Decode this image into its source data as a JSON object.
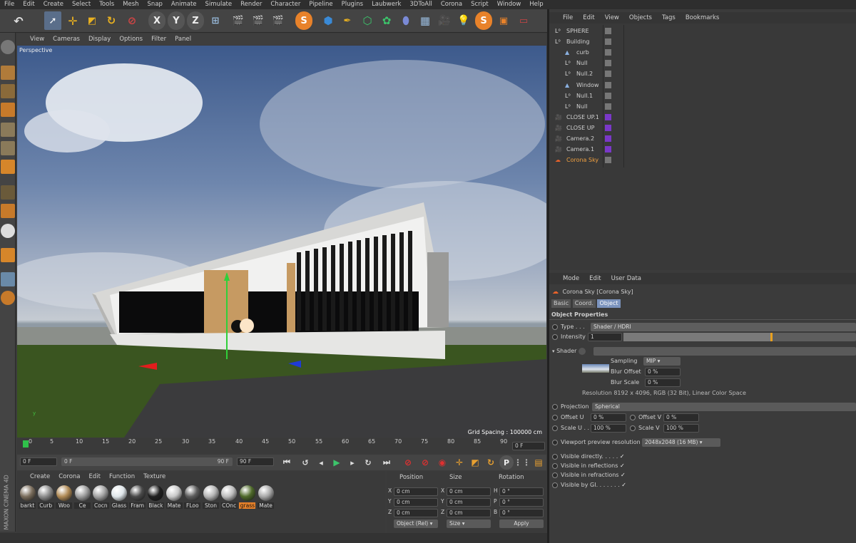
{
  "menu": [
    "File",
    "Edit",
    "Create",
    "Select",
    "Tools",
    "Mesh",
    "Snap",
    "Animate",
    "Simulate",
    "Render",
    "Character",
    "Pipeline",
    "Plugins",
    "Laubwerk",
    "3DToAll",
    "Corona",
    "Script",
    "Window",
    "Help"
  ],
  "toolbar": {
    "axis_x": "X",
    "axis_y": "Y",
    "axis_z": "Z",
    "icons": [
      "undo-icon",
      "select-arrow-icon",
      "move-icon",
      "scale-icon",
      "rotate-icon",
      "recent-tool-icon",
      "axis-lock-x",
      "axis-lock-y",
      "axis-lock-z",
      "world-coordinate-icon",
      "render-view-icon",
      "render-picture-viewer-icon",
      "render-settings-icon",
      "corona-icon",
      "cube-icon",
      "pen-icon",
      "subdivision-icon",
      "cloner-icon",
      "deformer-icon",
      "floor-icon",
      "camera-icon",
      "light-icon",
      "corona-logo-icon",
      "cinema-layout-icon"
    ]
  },
  "viewport": {
    "menu": [
      "View",
      "Cameras",
      "Display",
      "Options",
      "Filter",
      "Panel"
    ],
    "label": "Perspective",
    "grid_spacing": "Grid Spacing : 100000 cm"
  },
  "timeline": {
    "ticks": [
      "0",
      "5",
      "10",
      "15",
      "20",
      "25",
      "30",
      "35",
      "40",
      "45",
      "50",
      "55",
      "60",
      "65",
      "70",
      "75",
      "80",
      "85",
      "90"
    ],
    "current_frame": "0 F"
  },
  "transport": {
    "start": "0 F",
    "min": "0 F",
    "max": "90 F",
    "end": "90 F"
  },
  "materials": {
    "menu": [
      "Create",
      "Corona",
      "Edit",
      "Function",
      "Texture"
    ],
    "items": [
      {
        "label": "barkt",
        "color": "#7a6d5c"
      },
      {
        "label": "Curb",
        "color": "#8d8d8d"
      },
      {
        "label": "Woo",
        "color": "#b08a55"
      },
      {
        "label": "Ce",
        "color": "#9c9c9c"
      },
      {
        "label": "Cocn",
        "color": "#a3a3a3"
      },
      {
        "label": "Glass",
        "color": "#dfe6ea"
      },
      {
        "label": "Fram",
        "color": "#4a4a4a"
      },
      {
        "label": "Black",
        "color": "#202020"
      },
      {
        "label": "Mate",
        "color": "#c9c9c9"
      },
      {
        "label": "FLoo",
        "color": "#5c5c5c"
      },
      {
        "label": "Ston",
        "color": "#b5b5b5"
      },
      {
        "label": "COnc",
        "color": "#bdbdbd"
      },
      {
        "label": "grass",
        "color": "#4f6a2a"
      },
      {
        "label": "Mate",
        "color": "#a8a8a8"
      }
    ]
  },
  "coords": {
    "headers": {
      "position": "Position",
      "size": "Size",
      "rotation": "Rotation"
    },
    "rows": [
      {
        "axis": "X",
        "pos": "0 cm",
        "size_axis": "X",
        "size": "0 cm",
        "rot_axis": "H",
        "rot": "0 °"
      },
      {
        "axis": "Y",
        "pos": "0 cm",
        "size_axis": "Y",
        "size": "0 cm",
        "rot_axis": "P",
        "rot": "0 °"
      },
      {
        "axis": "Z",
        "pos": "0 cm",
        "size_axis": "Z",
        "size": "0 cm",
        "rot_axis": "B",
        "rot": "0 °"
      }
    ],
    "mode": "Object (Rel)",
    "size_mode": "Size",
    "apply": "Apply"
  },
  "objects": {
    "menu": [
      "File",
      "Edit",
      "View",
      "Objects",
      "Tags",
      "Bookmarks"
    ],
    "items": [
      {
        "name": "SPHERE",
        "indent": 0,
        "type": "null"
      },
      {
        "name": "Building",
        "indent": 0,
        "type": "null"
      },
      {
        "name": "curb",
        "indent": 1,
        "type": "poly"
      },
      {
        "name": "Null",
        "indent": 1,
        "type": "null"
      },
      {
        "name": "Null.2",
        "indent": 1,
        "type": "null"
      },
      {
        "name": "Window",
        "indent": 1,
        "type": "poly"
      },
      {
        "name": "Null.1",
        "indent": 1,
        "type": "null"
      },
      {
        "name": "Null",
        "indent": 1,
        "type": "null"
      },
      {
        "name": "CLOSE UP.1",
        "indent": 0,
        "type": "camera"
      },
      {
        "name": "CLOSE UP",
        "indent": 0,
        "type": "camera"
      },
      {
        "name": "Camera.2",
        "indent": 0,
        "type": "camera"
      },
      {
        "name": "Camera.1",
        "indent": 0,
        "type": "camera"
      },
      {
        "name": "Corona Sky",
        "indent": 0,
        "type": "sky"
      }
    ]
  },
  "attributes": {
    "menu": [
      "Mode",
      "Edit",
      "User Data"
    ],
    "title": "Corona Sky [Corona Sky]",
    "tabs": [
      "Basic",
      "Coord.",
      "Object"
    ],
    "section": "Object Properties",
    "type_label": "Type . . .",
    "type_value": "Shader / HDRI",
    "intensity_label": "Intensity",
    "intensity_value": "1",
    "shader_label": "Shader",
    "sampling_label": "Sampling",
    "sampling_value": "MIP",
    "blur_offset_label": "Blur Offset",
    "blur_offset_value": "0 %",
    "blur_scale_label": "Blur Scale",
    "blur_scale_value": "0 %",
    "resolution": "Resolution 8192 x 4096, RGB (32 Bit), Linear Color Space",
    "projection_label": "Projection",
    "projection_value": "Spherical",
    "offset_u_label": "Offset U",
    "offset_u_value": "0 %",
    "offset_v_label": "Offset V",
    "offset_v_value": "0 %",
    "scale_u_label": "Scale U . .",
    "scale_u_value": "100 %",
    "scale_v_label": "Scale V",
    "scale_v_value": "100 %",
    "viewport_res_label": "Viewport preview resolution",
    "viewport_res_value": "2048x2048 (16 MB)",
    "visible_directly": "Visible directly. . . . .",
    "visible_reflections": "Visible in reflections",
    "visible_refractions": "Visible in refractions",
    "visible_gi": "Visible by GI. . . . . . .",
    "check": "✓"
  },
  "brand": "MAXON CINEMA 4D"
}
